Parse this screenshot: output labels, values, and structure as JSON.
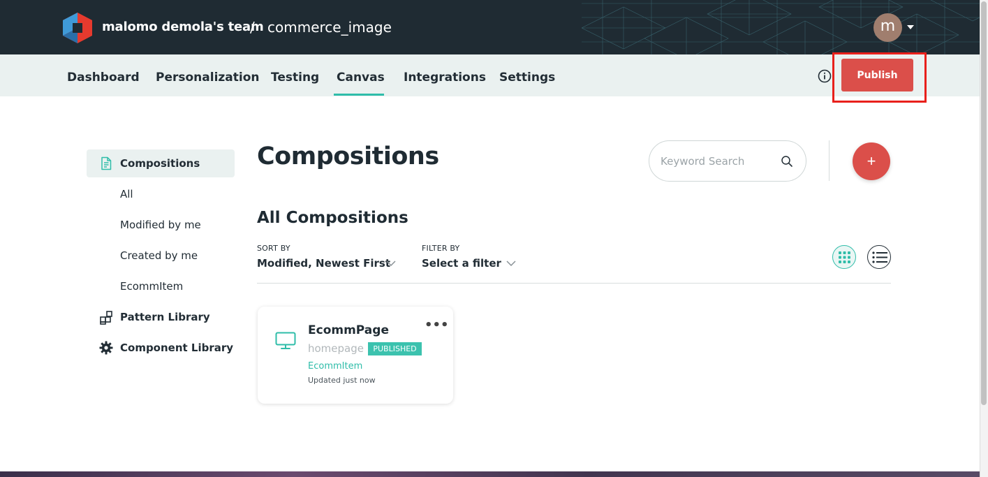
{
  "header": {
    "team_name": "malomo demola's team",
    "separator": "/",
    "project_name": "commerce_image",
    "avatar_initial": "m"
  },
  "nav": {
    "tabs": [
      {
        "label": "Dashboard"
      },
      {
        "label": "Personalization"
      },
      {
        "label": "Testing"
      },
      {
        "label": "Canvas",
        "active": true
      },
      {
        "label": "Integrations"
      },
      {
        "label": "Settings"
      }
    ],
    "publish_label": "Publish"
  },
  "sidebar": {
    "compositions_label": "Compositions",
    "sub_items": [
      "All",
      "Modified by me",
      "Created by me",
      "EcommItem"
    ],
    "pattern_library_label": "Pattern Library",
    "component_library_label": "Component Library"
  },
  "main": {
    "title": "Compositions",
    "search_placeholder": "Keyword Search",
    "add_label": "+",
    "section_title": "All Compositions",
    "sort_caption": "SORT BY",
    "sort_value": "Modified, Newest First",
    "filter_caption": "FILTER BY",
    "filter_value": "Select a filter"
  },
  "cards": [
    {
      "title": "EcommPage",
      "slug": "homepage",
      "status": "PUBLISHED",
      "type": "EcommItem",
      "updated": "Updated just now",
      "menu": "•••"
    }
  ],
  "colors": {
    "topbar": "#1f2b33",
    "nav_bg": "#eaf1f0",
    "accent": "#2fbda9",
    "primary": "#db4f4a",
    "highlight": "#e8201b"
  }
}
